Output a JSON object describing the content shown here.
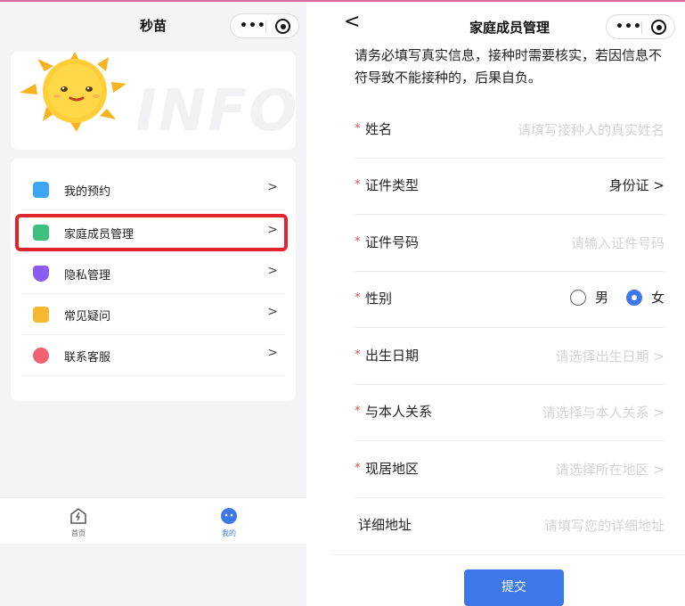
{
  "left": {
    "nav_title": "秒苗",
    "capsule_icons": [
      "more-dots-icon",
      "mini-program-close-icon"
    ],
    "banner_watermark": "INFO",
    "menu": [
      {
        "label": "我的预约",
        "icon": "appointment-icon",
        "color": "#3da5f5"
      },
      {
        "label": "家庭成员管理",
        "icon": "family-icon",
        "color": "#3dbf7e"
      },
      {
        "label": "隐私管理",
        "icon": "privacy-shield-icon",
        "color": "#8a5cf5"
      },
      {
        "label": "常见疑问",
        "icon": "faq-icon",
        "color": "#f5b82e"
      },
      {
        "label": "联系客服",
        "icon": "customer-service-icon",
        "color": "#f06272"
      }
    ],
    "menu_arrow": ">",
    "highlight_color": "#e3232c",
    "tabs": [
      {
        "label": "首页",
        "icon": "home-icon"
      },
      {
        "label": "我的",
        "icon": "profile-icon",
        "color": "#3e78e8"
      }
    ]
  },
  "right": {
    "back_glyph": "<",
    "title": "家庭成员管理",
    "notice": "请务必填写真实信息，接种时需要核实，若因信息不符导致不能接种的，后果自负。",
    "required_mark": "*",
    "fields": {
      "name": {
        "label": "姓名",
        "placeholder": "请填写接种人的真实姓名"
      },
      "id_type": {
        "label": "证件类型",
        "value": "身份证 >"
      },
      "id_number": {
        "label": "证件号码",
        "placeholder": "请输入证件号码"
      },
      "gender": {
        "label": "性别",
        "options": [
          "男",
          "女"
        ],
        "selected": "女"
      },
      "birth_date": {
        "label": "出生日期",
        "placeholder": "请选择出生日期 >"
      },
      "relation": {
        "label": "与本人关系",
        "placeholder": "请选择与本人关系 >"
      },
      "region": {
        "label": "现居地区",
        "placeholder": "请选择所在地区 >"
      },
      "address": {
        "label": "详细地址",
        "placeholder": "请填写您的详细地址"
      }
    },
    "submit_label": "提交",
    "accent_color": "#3e78e8"
  }
}
